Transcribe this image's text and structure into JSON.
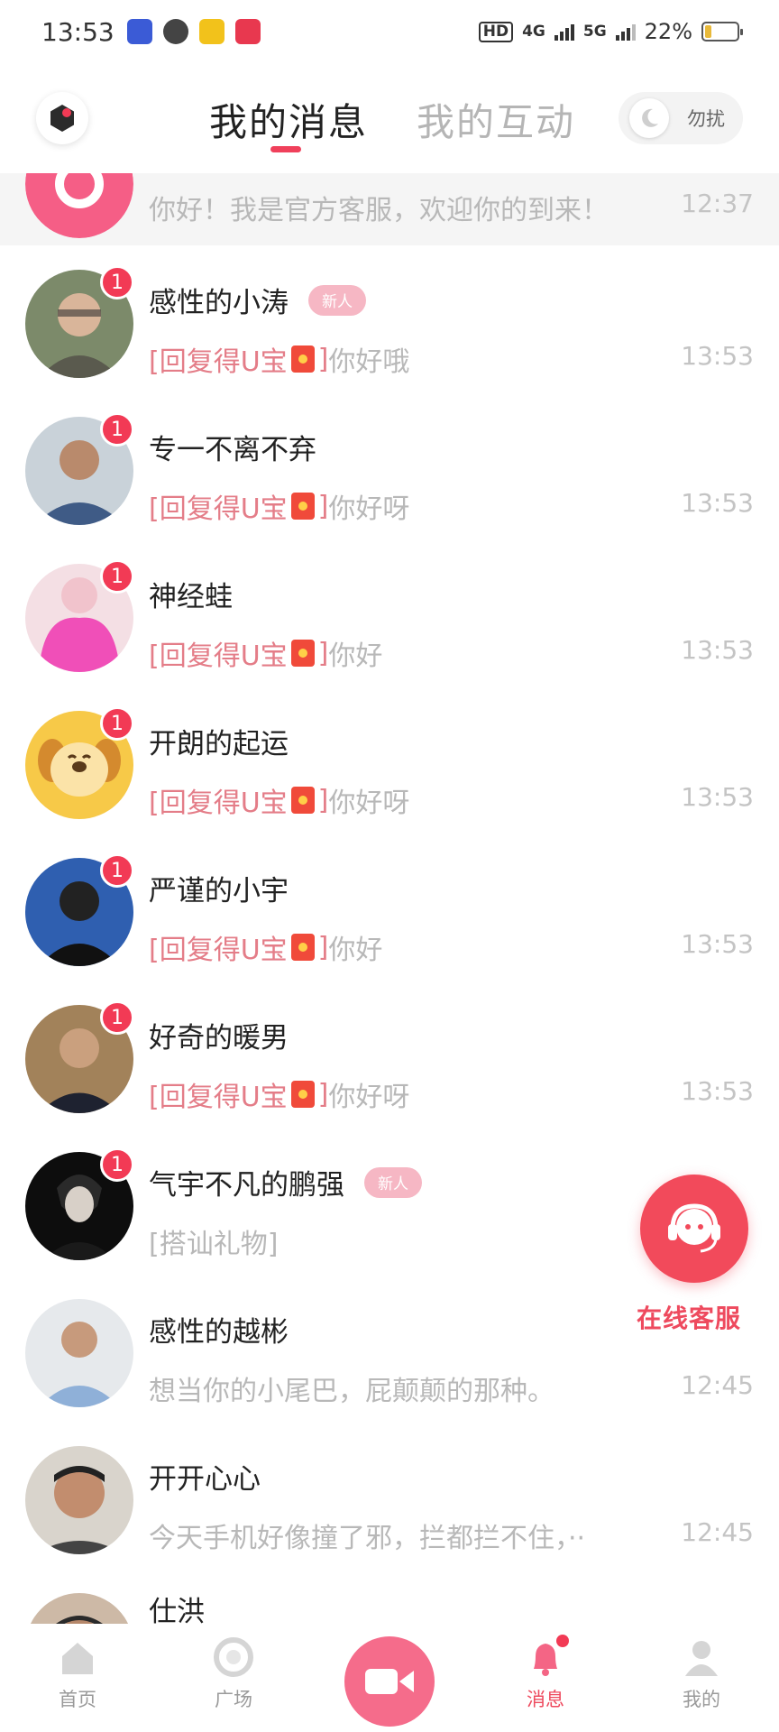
{
  "status_bar": {
    "time": "13:53",
    "net_hd": "HD",
    "net_4g": "4G",
    "net_5g": "5G",
    "battery": "22%",
    "battery_level": 0.22
  },
  "header": {
    "tab_messages": "我的消息",
    "tab_interactions": "我的互动",
    "dnd_label": "勿扰"
  },
  "pinned": {
    "preview": "你好！我是官方客服，欢迎你的到来！",
    "time": "12:37"
  },
  "reward_label": "[回复得U宝",
  "reward_close": "]",
  "messages": [
    {
      "name": "感性的小涛",
      "badge": "新人",
      "unread": "1",
      "text": "你好哦",
      "time": "13:53"
    },
    {
      "name": "专一不离不弃",
      "badge": "",
      "unread": "1",
      "text": "你好呀",
      "time": "13:53"
    },
    {
      "name": "神经蛙",
      "badge": "",
      "unread": "1",
      "text": "你好",
      "time": "13:53"
    },
    {
      "name": "开朗的起运",
      "badge": "",
      "unread": "1",
      "text": "你好呀",
      "time": "13:53"
    },
    {
      "name": "严谨的小宇",
      "badge": "",
      "unread": "1",
      "text": "你好",
      "time": "13:53"
    },
    {
      "name": "好奇的暖男",
      "badge": "",
      "unread": "1",
      "text": "你好呀",
      "time": "13:53"
    },
    {
      "name": "气宇不凡的鹏强",
      "badge": "新人",
      "unread": "1",
      "text": "[搭讪礼物]",
      "time": ""
    },
    {
      "name": "感性的越彬",
      "badge": "",
      "unread": "",
      "text": "想当你的小尾巴，屁颠颠的那种。",
      "time": "12:45"
    },
    {
      "name": "开开心心",
      "badge": "",
      "unread": "",
      "text": "今天手机好像撞了邪，拦都拦不住，··",
      "time": "12:45"
    },
    {
      "name": "仕洪",
      "badge": "",
      "unread": "",
      "text": "",
      "time": ""
    }
  ],
  "float_service": {
    "label": "在线客服"
  },
  "bottom_nav": {
    "home": "首页",
    "square": "广场",
    "messages": "消息",
    "me": "我的"
  },
  "colors": {
    "accent": "#f0405b",
    "reward_text": "#e47d88",
    "badge_bg": "#f6b7c4",
    "unread_bg": "#f23a55"
  },
  "icons": [
    "camera-icon",
    "moon-icon",
    "headset-icon",
    "home-icon",
    "square-icon",
    "video-icon",
    "bell-icon",
    "user-icon",
    "red-packet-icon"
  ]
}
